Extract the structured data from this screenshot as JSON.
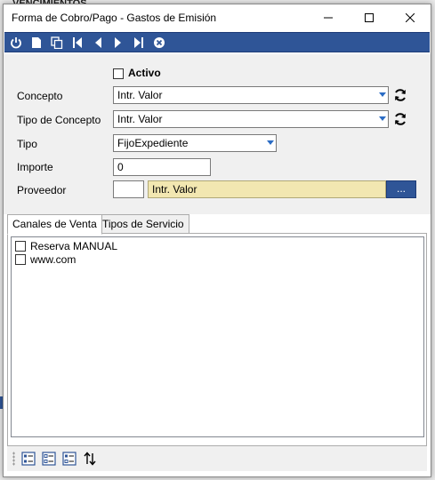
{
  "window": {
    "title": "Forma de Cobro/Pago - Gastos de Emisión",
    "background_header": "VENCIMIENTOS"
  },
  "toolbar": {
    "icons": [
      "power-icon",
      "new-document-icon",
      "copy-icon",
      "first-record-icon",
      "previous-record-icon",
      "next-record-icon",
      "last-record-icon",
      "cancel-icon"
    ]
  },
  "form": {
    "activo_label": "Activo",
    "activo_checked": false,
    "concepto_label": "Concepto",
    "concepto_value": "Intr. Valor",
    "tipo_concepto_label": "Tipo de Concepto",
    "tipo_concepto_value": "Intr. Valor",
    "tipo_label": "Tipo",
    "tipo_value": "FijoExpediente",
    "importe_label": "Importe",
    "importe_value": "0",
    "proveedor_label": "Proveedor",
    "proveedor_code": "",
    "proveedor_name": "Intr. Valor",
    "proveedor_button": "..."
  },
  "tabs": [
    {
      "label": "Canales de Venta",
      "active": true
    },
    {
      "label": "Tipos de Servicio",
      "active": false
    }
  ],
  "canales": [
    {
      "label": "Reserva MANUAL",
      "checked": false
    },
    {
      "label": "www.com",
      "checked": false
    }
  ],
  "colors": {
    "accent": "#2f5597",
    "highlight_field": "#f2e7b1"
  }
}
